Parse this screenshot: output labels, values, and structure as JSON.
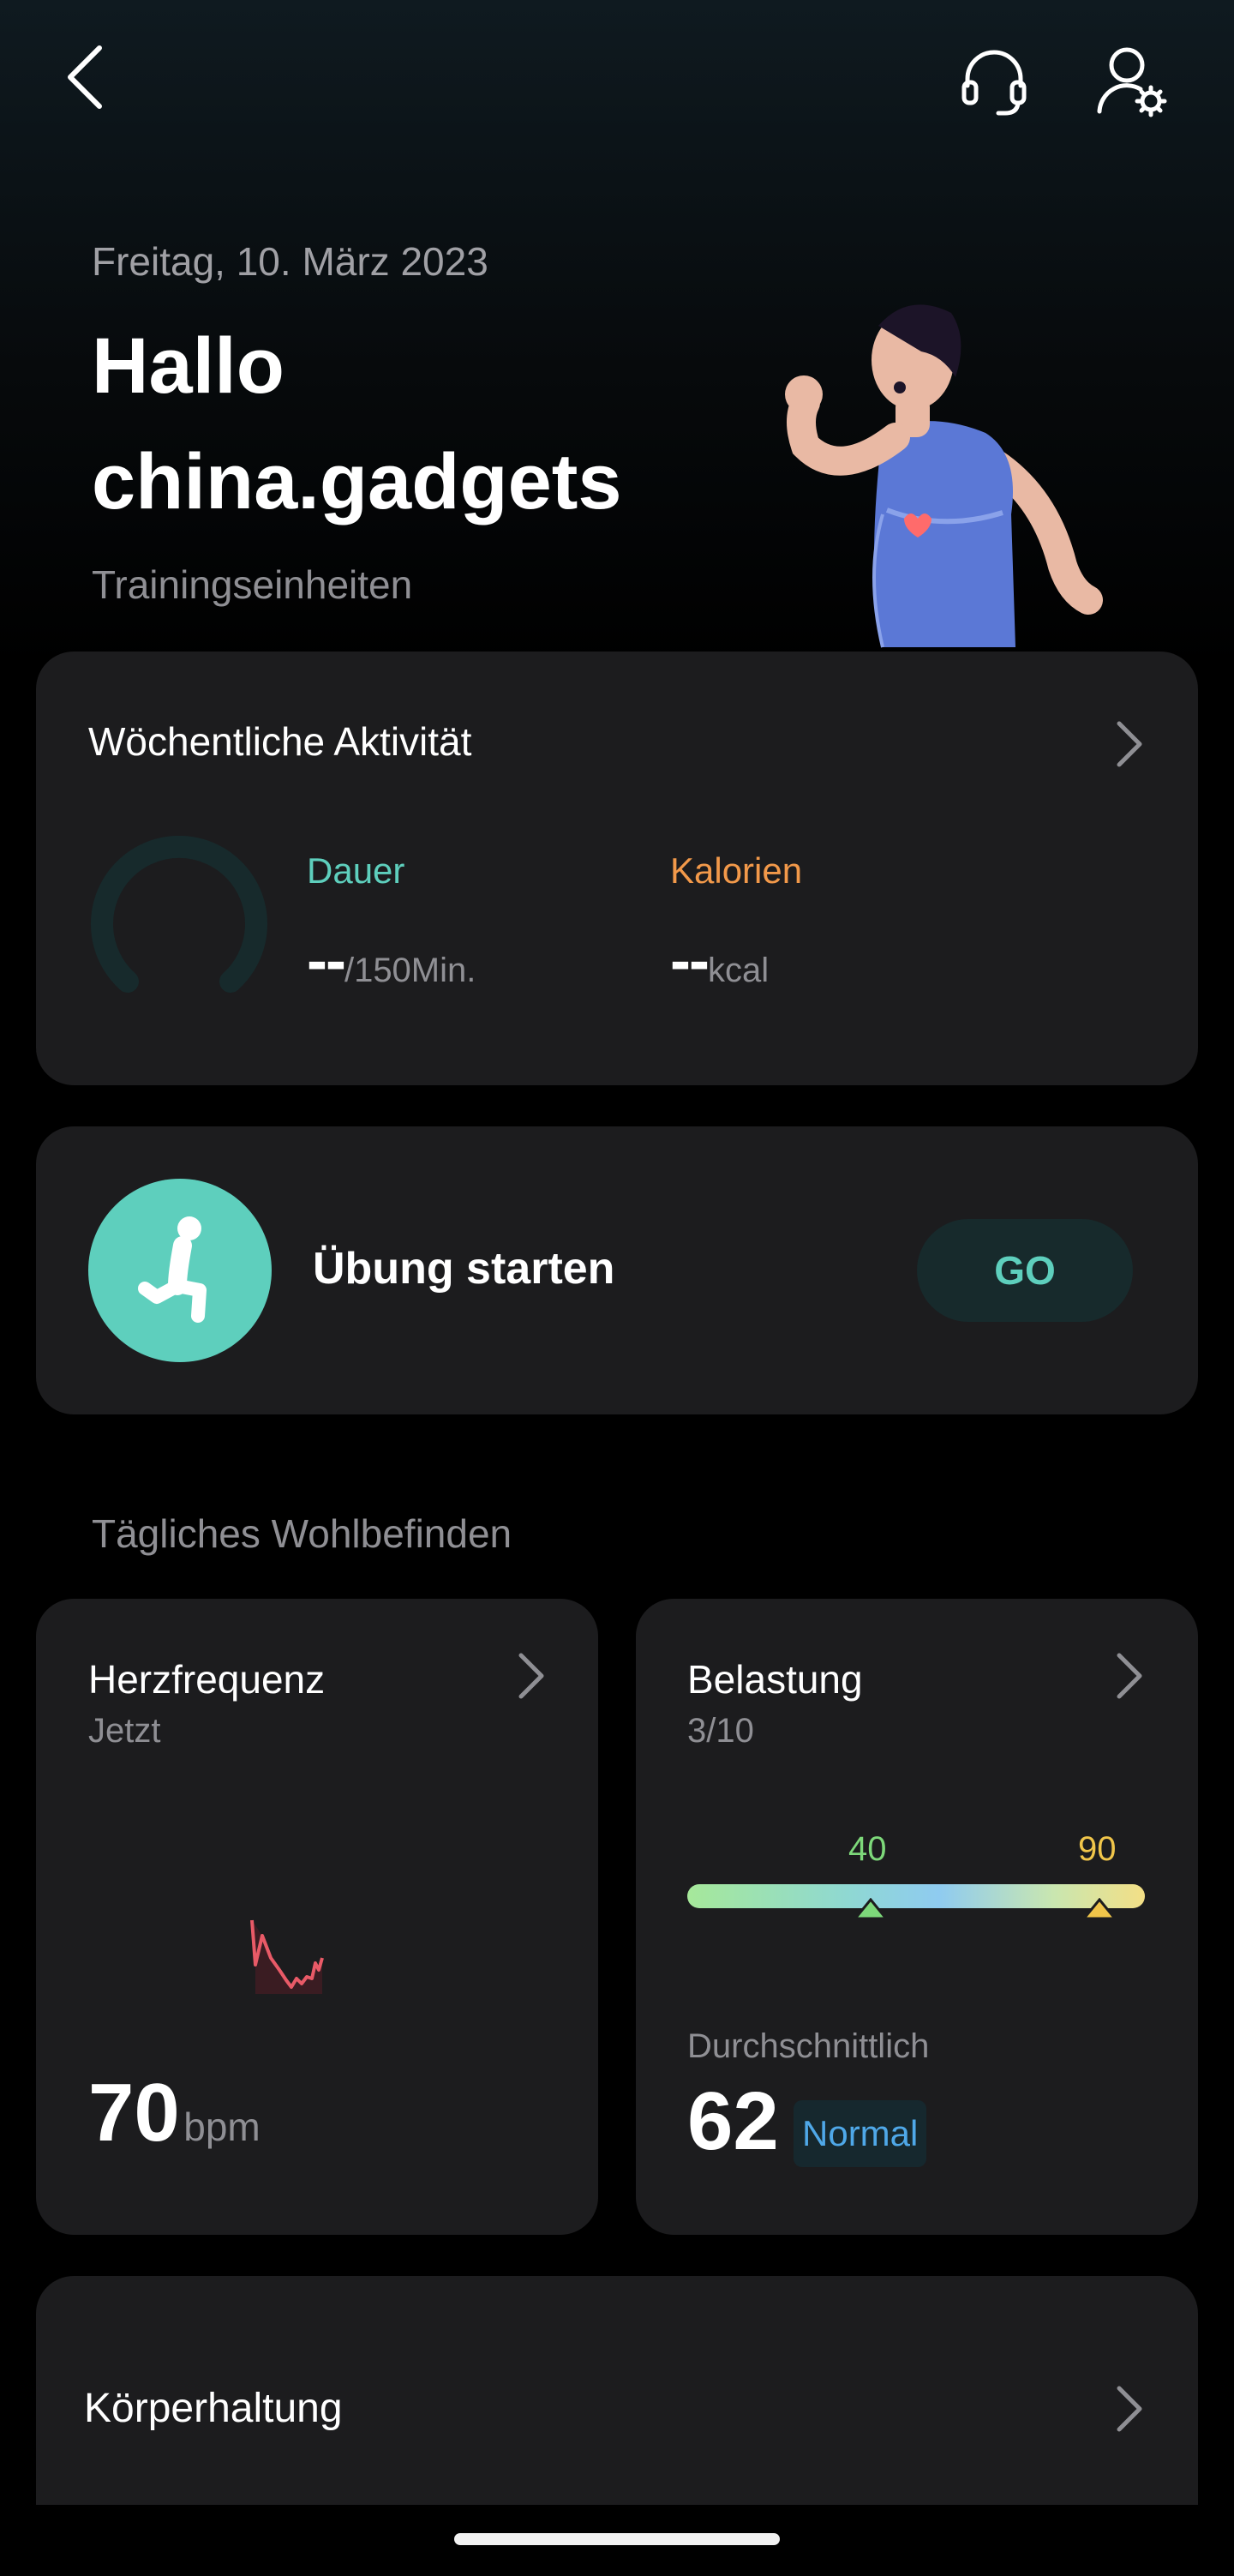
{
  "header": {
    "date": "Freitag, 10. März 2023",
    "greeting_line1": "Hallo",
    "greeting_line2": "china.gadgets",
    "subtitle": "Trainingseinheiten"
  },
  "weekly": {
    "title": "Wöchentliche Aktivität",
    "duration_label": "Dauer",
    "duration_value": "--",
    "duration_unit": "/150Min.",
    "calories_label": "Kalorien",
    "calories_value": "--",
    "calories_unit": "kcal",
    "progress_fraction": 0
  },
  "exercise": {
    "title": "Übung starten",
    "go_label": "GO"
  },
  "wellbeing": {
    "section_title": "Tägliches Wohlbefinden",
    "heart": {
      "title": "Herzfrequenz",
      "subtitle": "Jetzt",
      "value": "70",
      "unit": "bpm"
    },
    "stress": {
      "title": "Belastung",
      "subtitle": "3/10",
      "marker_low": "40",
      "marker_high": "90",
      "avg_label": "Durchschnittlich",
      "avg_value": "62",
      "status": "Normal"
    }
  },
  "posture": {
    "title": "Körperhaltung"
  },
  "colors": {
    "accent_teal": "#5ecfbd",
    "duration_color": "#5ecfbd",
    "calories_color": "#f2994a",
    "heart_line": "#e85a67",
    "marker_low_color": "#7dd87a",
    "marker_high_color": "#f0c54a",
    "status_blue": "#4fa8e8"
  },
  "icons": {
    "back": "chevron-left-icon",
    "support": "headset-icon",
    "profile": "user-settings-icon",
    "exercise": "running-person-icon"
  }
}
